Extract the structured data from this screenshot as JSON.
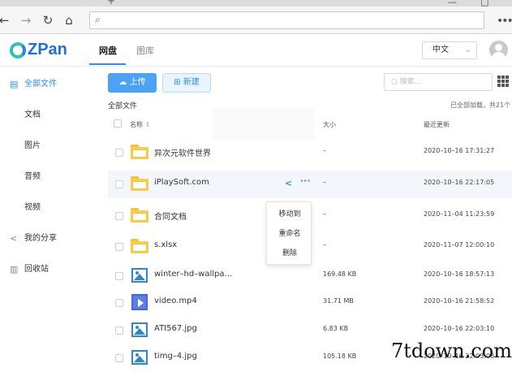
{
  "browser": {
    "newtab": "+",
    "window_controls": [
      "—",
      "□"
    ],
    "nav": {
      "back": "←",
      "forward": "→",
      "refresh": "↻",
      "home": "⌂"
    },
    "search_glyph": "⌕",
    "menu": "•••"
  },
  "header": {
    "logo": "ZPan",
    "tabs": [
      {
        "label": "网盘"
      },
      {
        "label": "图库"
      }
    ],
    "language": "中文"
  },
  "sidebar": {
    "items": [
      {
        "label": "全部文件",
        "icon": "document-icon",
        "active": true
      },
      {
        "label": "文档"
      },
      {
        "label": "图片"
      },
      {
        "label": "音频"
      },
      {
        "label": "视频"
      },
      {
        "label": "我的分享",
        "icon": "share-icon"
      },
      {
        "label": "回收站",
        "icon": "trash-icon"
      }
    ]
  },
  "toolbar": {
    "upload_label": "上传",
    "new_label": "新建",
    "search_placeholder": "搜索..."
  },
  "breadcrumb": "全部文件",
  "status": "已全部加载，共21个",
  "table": {
    "columns": {
      "name": "名称",
      "size": "大小",
      "updated": "最近更新"
    },
    "rows": [
      {
        "name": "异次元软件世界",
        "type": "folder",
        "size": "–",
        "date": "2020–10–16 17:31:27"
      },
      {
        "name": "iPlaySoft.com",
        "type": "folder",
        "size": "–",
        "date": "2020–10–16 22:17:05"
      },
      {
        "name": "合同文档",
        "type": "folder",
        "size": "–",
        "date": "2020–11–04 11:23:59"
      },
      {
        "name": "s.xlsx",
        "type": "folder",
        "size": "–",
        "date": "2020–11–07 12:00:10"
      },
      {
        "name": "winter–hd–wallpa…",
        "type": "image",
        "size": "169.48 KB",
        "date": "2020–10–16 18:57:13"
      },
      {
        "name": "video.mp4",
        "type": "video",
        "size": "31.71 MB",
        "date": "2020–10–16 21:58:52"
      },
      {
        "name": "ATI567.jpg",
        "type": "image",
        "size": "6.83 KB",
        "date": "2020–10–16 22:03:10"
      },
      {
        "name": "timg–4.jpg",
        "type": "image",
        "size": "105.18 KB",
        "date": "2020–10–16 22:03:08"
      }
    ]
  },
  "context_menu": {
    "items": [
      "移动到",
      "重命名",
      "删除"
    ]
  },
  "watermark": "7tdown.com",
  "colors": {
    "accent": "#2b8ef0",
    "folder": "#f8cf4a",
    "logo_teal": "#2ec1b7"
  }
}
